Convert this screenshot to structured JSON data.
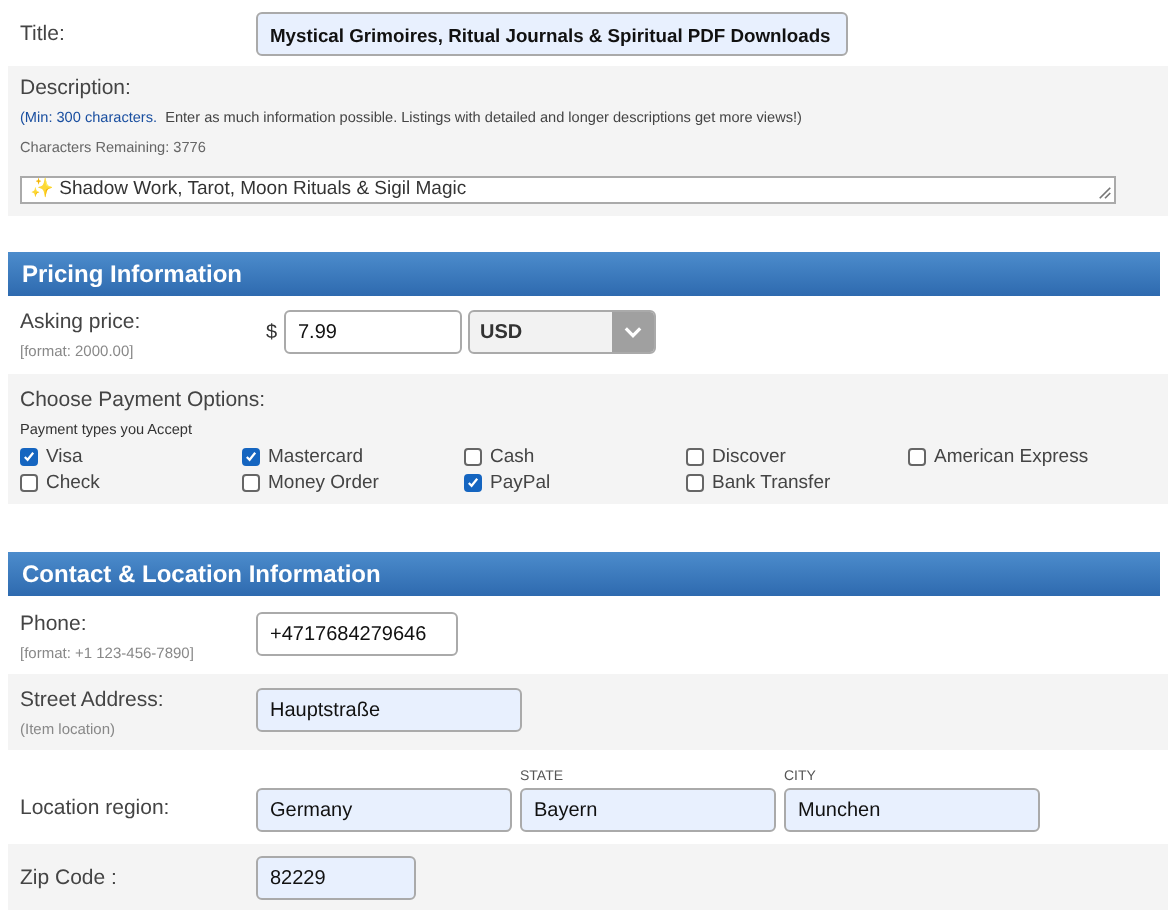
{
  "title_field": {
    "label": "Title:",
    "value": "Mystical Grimoires, Ritual Journals & Spiritual PDF Downloads"
  },
  "description": {
    "label": "Description:",
    "hint_link": "(Min: 300 characters.",
    "hint": "Enter as much information possible. Listings with detailed and longer descriptions get more views!)",
    "remaining": "Characters Remaining: 3776",
    "value": "✨ Shadow Work, Tarot, Moon Rituals & Sigil Magic"
  },
  "pricing": {
    "header": "Pricing Information",
    "label": "Asking price:",
    "format": "[format: 2000.00]",
    "currency_symbol": "$",
    "price": "7.99",
    "currency": "USD"
  },
  "payment": {
    "label": "Choose Payment Options:",
    "sublabel": "Payment types you Accept",
    "options": [
      {
        "label": "Visa",
        "checked": true
      },
      {
        "label": "Mastercard",
        "checked": true
      },
      {
        "label": "Cash",
        "checked": false
      },
      {
        "label": "Discover",
        "checked": false
      },
      {
        "label": "American Express",
        "checked": false
      },
      {
        "label": "Check",
        "checked": false
      },
      {
        "label": "Money Order",
        "checked": false
      },
      {
        "label": "PayPal",
        "checked": true
      },
      {
        "label": "Bank Transfer",
        "checked": false
      }
    ]
  },
  "contact": {
    "header": "Contact & Location Information",
    "phone": {
      "label": "Phone:",
      "format": "[format: +1 123-456-7890]",
      "value": "+4717684279646"
    },
    "street": {
      "label": "Street Address:",
      "format": "(Item location)",
      "value": "Hauptstraße"
    },
    "region": {
      "label": "Location region:",
      "country": "Germany",
      "state_label": "STATE",
      "state": "Bayern",
      "city_label": "CITY",
      "city": "Munchen"
    },
    "zip": {
      "label": "Zip Code :",
      "value": "82229"
    }
  }
}
